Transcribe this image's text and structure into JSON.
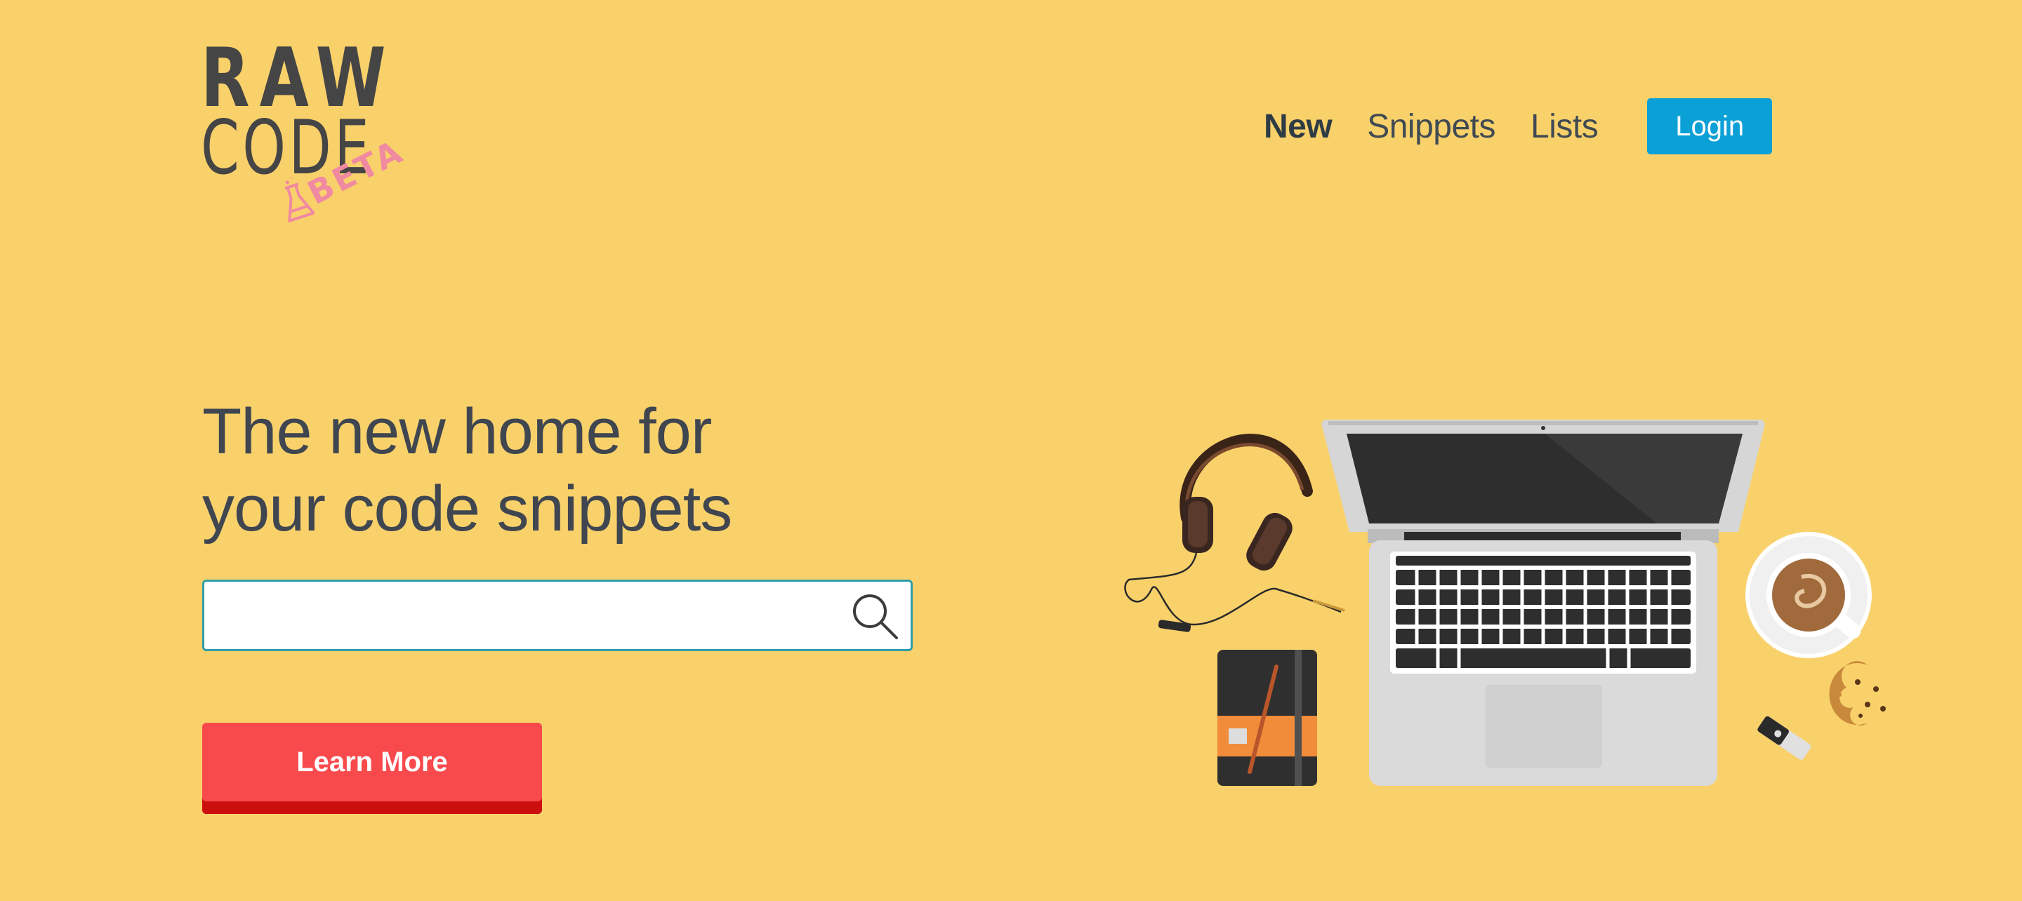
{
  "logo": {
    "line1": "RAW",
    "line2": "CODE",
    "badge": "BETA"
  },
  "nav": {
    "items": [
      {
        "label": "New",
        "active": true
      },
      {
        "label": "Snippets",
        "active": false
      },
      {
        "label": "Lists",
        "active": false
      }
    ],
    "login_label": "Login"
  },
  "hero": {
    "title_line1": "The new home for",
    "title_line2": "your code snippets"
  },
  "search": {
    "value": "",
    "placeholder": ""
  },
  "cta": {
    "learn_more_label": "Learn More"
  },
  "colors": {
    "background": "#f9d16b",
    "login_button": "#0ba0d6",
    "learn_more_button": "#f84a4c",
    "learn_more_shadow": "#cc0e0e",
    "search_border": "#2f9ea8",
    "beta_badge": "#f08aa0"
  },
  "icons": {
    "search": "search-icon",
    "flask": "flask-icon"
  }
}
